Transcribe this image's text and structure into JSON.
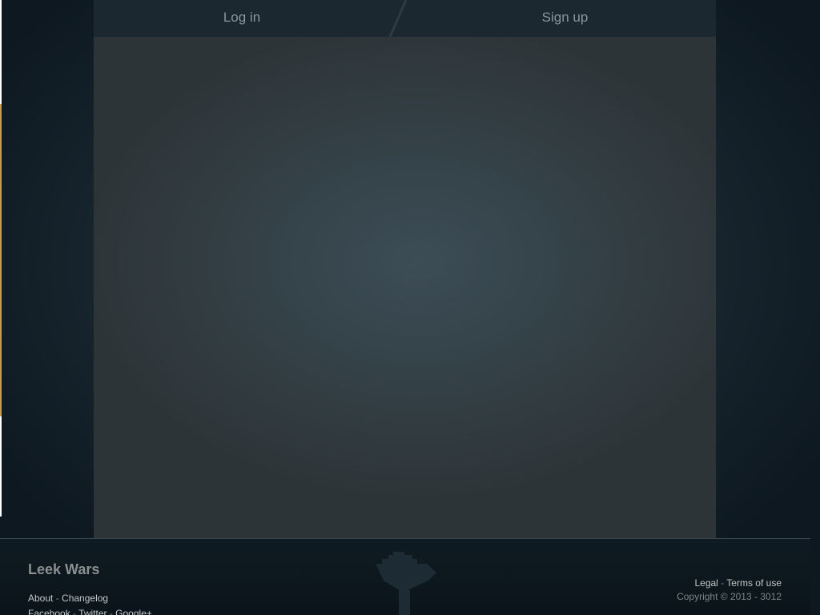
{
  "header": {
    "login_label": "Log in",
    "signup_label": "Sign up"
  },
  "footer": {
    "brand": "Leek Wars",
    "links_row1": [
      "About",
      "Changelog"
    ],
    "links_row2": [
      "Facebook",
      "Twitter",
      "Google+"
    ],
    "separator": " - ",
    "legal_links": [
      "Legal",
      "Terms of use"
    ],
    "copyright": "Copyright © 2013 - 3012",
    "logo_icon": "leek-icon"
  },
  "colors": {
    "background": "#0e1a21",
    "panel": "#35434a",
    "topbar": "#1b2830",
    "text_muted": "#8a969c"
  }
}
